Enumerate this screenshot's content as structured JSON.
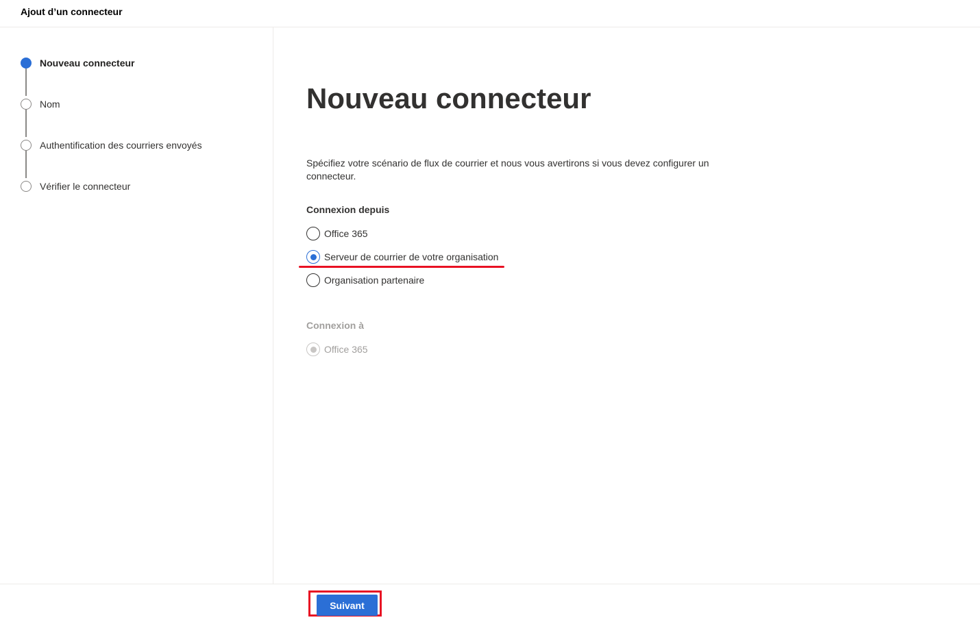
{
  "header": {
    "title": "Ajout d’un connecteur"
  },
  "steps": [
    {
      "label": "Nouveau connecteur",
      "active": true
    },
    {
      "label": "Nom",
      "active": false
    },
    {
      "label": "Authentification des courriers envoyés",
      "active": false
    },
    {
      "label": "Vérifier le connecteur",
      "active": false
    }
  ],
  "main": {
    "title": "Nouveau connecteur",
    "description": "Spécifiez votre scénario de flux de courrier et nous vous avertirons si vous devez configurer un connecteur.",
    "from_section": {
      "label": "Connexion depuis",
      "options": [
        {
          "label": "Office 365",
          "selected": false
        },
        {
          "label": "Serveur de courrier de votre organisation",
          "selected": true
        },
        {
          "label": "Organisation partenaire",
          "selected": false
        }
      ]
    },
    "to_section": {
      "label": "Connexion à",
      "options": [
        {
          "label": "Office 365",
          "selected": true,
          "disabled": true
        }
      ]
    }
  },
  "footer": {
    "next_label": "Suivant"
  },
  "colors": {
    "accent": "#2b6fd6",
    "annotation": "#e81123"
  }
}
